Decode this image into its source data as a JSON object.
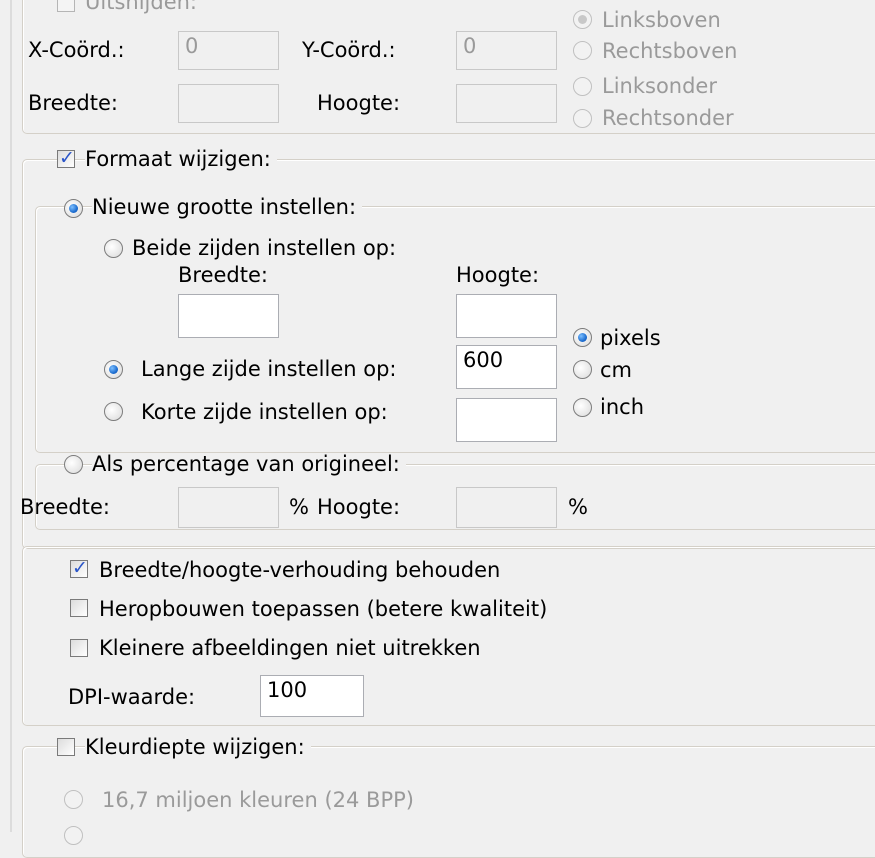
{
  "crop": {
    "checkbox_label": "Uitsnijden:",
    "x_label": "X-Coörd.:",
    "x_value": "0",
    "y_label": "Y-Coörd.:",
    "y_value": "0",
    "width_label": "Breedte:",
    "height_label": "Hoogte:",
    "positions": [
      "Linksboven",
      "Rechtsboven",
      "Linksonder",
      "Rechtsonder"
    ]
  },
  "resize": {
    "checkbox_label": "Formaat wijzigen:",
    "new_size_label": "Nieuwe grootte instellen:",
    "both_sides_label": "Beide zijden instellen op:",
    "width_label": "Breedte:",
    "height_label": "Hoogte:",
    "long_side_label": "Lange zijde instellen op:",
    "long_side_value": "600",
    "short_side_label": "Korte zijde instellen op:",
    "units": [
      "pixels",
      "cm",
      "inch"
    ],
    "percentage_label": "Als percentage van origineel:",
    "pct_width_label": "Breedte:",
    "pct_height_label": "Hoogte:",
    "pct_symbol": "%"
  },
  "options": {
    "keep_ratio_label": "Breedte/hoogte-verhouding behouden",
    "resample_label": "Heropbouwen toepassen (betere kwaliteit)",
    "no_stretch_label": "Kleinere afbeeldingen niet uitrekken",
    "dpi_label": "DPI-waarde:",
    "dpi_value": "100"
  },
  "color_depth": {
    "checkbox_label": "Kleurdiepte wijzigen:",
    "option_24bpp": "16,7 miljoen kleuren (24 BPP)"
  }
}
